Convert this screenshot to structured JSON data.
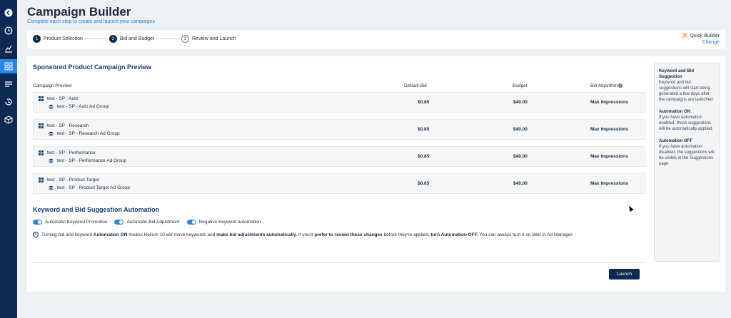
{
  "header": {
    "title": "Campaign Builder",
    "subtitle": "Complete each step to create and launch your campaigns"
  },
  "sidebar": {
    "icons": [
      "back-arrow-icon",
      "clock-icon",
      "analytics-icon",
      "dashboard-grid-icon",
      "list-icon",
      "history-icon",
      "box-icon"
    ],
    "active_index": 3
  },
  "stepper": {
    "steps": [
      {
        "num": "1",
        "label": "Product Selection"
      },
      {
        "num": "2",
        "label": "Bid and Budget"
      },
      {
        "num": "3",
        "label": "Review and Launch"
      }
    ],
    "quick_builder": {
      "badge": "9",
      "title": "Quick Builder",
      "change": "Change"
    }
  },
  "preview": {
    "title": "Sponsored Product Campaign Preview",
    "columns": {
      "campaign": "Campaign Preview",
      "default_bid": "Default Bid",
      "budget": "Budget",
      "algorithm": "Bid Algorithm"
    },
    "rows": [
      {
        "campaign": "test - SP - Auto",
        "group": "test - SP - Auto Ad Group",
        "bid": "$0.85",
        "budget": "$40.00",
        "algorithm": "Max Impressions"
      },
      {
        "campaign": "test - SP - Research",
        "group": "test - SP - Research Ad Group",
        "bid": "$0.85",
        "budget": "$40.00",
        "algorithm": "Max Impressions"
      },
      {
        "campaign": "test - SP - Performance",
        "group": "test - SP - Performance Ad Group",
        "bid": "$0.85",
        "budget": "$40.00",
        "algorithm": "Max Impressions"
      },
      {
        "campaign": "test - SP - Product Target",
        "group": "test - SP - Product Target Ad Group",
        "bid": "$0.85",
        "budget": "$40.00",
        "algorithm": "Max Impressions"
      }
    ]
  },
  "automation": {
    "title": "Keyword and Bid Suggestion Automation",
    "toggles": [
      {
        "label": "Automatic Keyword Promotion",
        "on": true
      },
      {
        "label": "Automatic Bid Adjustment",
        "on": true
      },
      {
        "label": "Negative Keyword automation",
        "on": true
      }
    ],
    "note": {
      "t1": "Turning bid and keyword ",
      "b1": "Automation ON",
      "t2": " means Helium 10 will move keywords and ",
      "b2": "make bid adjustments automatically.",
      "t3": " If you'd ",
      "b3": "prefer to review these changes",
      "t4": " before they're applied, ",
      "b4": "turn Automation OFF.",
      "t5": " You can always turn it on later in Ad Manager."
    }
  },
  "actions": {
    "launch": "Launch"
  },
  "side_panel": {
    "h1": "Keyword and Bid Suggestion",
    "p1": "Keyword and bid suggestions will start being generated a few days after the campaigns are launched.",
    "h2": "Automation ON",
    "p2": "If you have automation enabled, those suggestions will be automatically applied.",
    "h3": "Automation OFF",
    "p3": "If you have automation disabled, the suggestions will be visible in the Suggestions page"
  }
}
